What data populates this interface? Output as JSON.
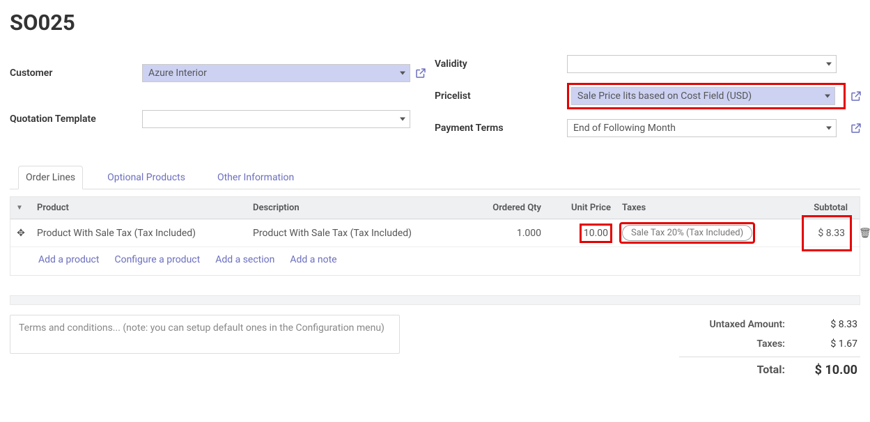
{
  "title": "SO025",
  "left_fields": {
    "customer_label": "Customer",
    "customer_value": "Azure Interior",
    "template_label": "Quotation Template",
    "template_value": ""
  },
  "right_fields": {
    "validity_label": "Validity",
    "validity_value": "",
    "pricelist_label": "Pricelist",
    "pricelist_value": "Sale Price lits based on Cost Field (USD)",
    "payment_label": "Payment Terms",
    "payment_value": "End of Following Month"
  },
  "tabs": {
    "order_lines": "Order Lines",
    "optional": "Optional Products",
    "other": "Other Information"
  },
  "grid": {
    "headers": {
      "product": "Product",
      "description": "Description",
      "qty": "Ordered Qty",
      "unit_price": "Unit Price",
      "taxes": "Taxes",
      "subtotal": "Subtotal"
    },
    "rows": [
      {
        "product": "Product With Sale Tax (Tax Included)",
        "description": "Product With Sale Tax (Tax Included)",
        "qty": "1.000",
        "unit_price": "10.00",
        "taxes": "Sale Tax 20% (Tax Included)",
        "subtotal": "$ 8.33"
      }
    ],
    "actions": {
      "add_product": "Add a product",
      "configure": "Configure a product",
      "add_section": "Add a section",
      "add_note": "Add a note"
    }
  },
  "terms_placeholder": "Terms and conditions... (note: you can setup default ones in the Configuration menu)",
  "totals": {
    "untaxed_label": "Untaxed Amount:",
    "untaxed_value": "$ 8.33",
    "taxes_label": "Taxes:",
    "taxes_value": "$ 1.67",
    "total_label": "Total:",
    "total_value": "$ 10.00"
  }
}
